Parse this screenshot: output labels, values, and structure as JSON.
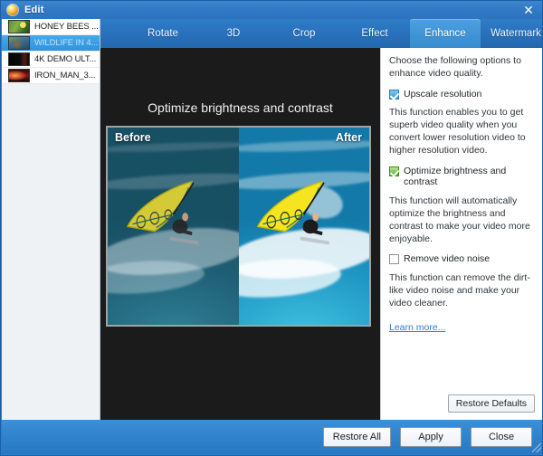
{
  "window": {
    "title": "Edit",
    "icon": "app-logo-icon",
    "close_label": "✕"
  },
  "sidebar": {
    "items": [
      {
        "label": "HONEY BEES ...",
        "thumb": "bees",
        "selected": false
      },
      {
        "label": "WILDLIFE IN 4...",
        "thumb": "wild",
        "selected": true
      },
      {
        "label": "4K DEMO ULT...",
        "thumb": "demo",
        "selected": false
      },
      {
        "label": "IRON_MAN_3...",
        "thumb": "iron",
        "selected": false
      }
    ]
  },
  "tabs": [
    {
      "label": "Rotate",
      "active": false
    },
    {
      "label": "3D",
      "active": false
    },
    {
      "label": "Crop",
      "active": false
    },
    {
      "label": "Effect",
      "active": false
    },
    {
      "label": "Enhance",
      "active": true
    },
    {
      "label": "Watermark",
      "active": false
    }
  ],
  "preview": {
    "title": "Optimize brightness and contrast",
    "before_label": "Before",
    "after_label": "After"
  },
  "options": {
    "intro": "Choose the following options to enhance video quality.",
    "items": [
      {
        "label": "Upscale resolution",
        "checked": true,
        "check_color": "#2f9bdb",
        "description": "This function enables you to get superb video quality when you convert lower resolution video to higher resolution video."
      },
      {
        "label": "Optimize brightness and contrast",
        "checked": true,
        "check_color": "#55ad2c",
        "description": "This function will automatically optimize the brightness and contrast to make your video more enjoyable."
      },
      {
        "label": "Remove video noise",
        "checked": false,
        "check_color": "#8a9199",
        "description": "This function can remove the dirt-like video noise and make your video cleaner."
      }
    ],
    "learn_more": "Learn more...",
    "restore_defaults": "Restore Defaults"
  },
  "footer": {
    "buttons": [
      {
        "label": "Restore All"
      },
      {
        "label": "Apply"
      },
      {
        "label": "Close"
      }
    ]
  },
  "colors": {
    "accent": "#2a7fd4",
    "tab_active": "#3e93d5",
    "panel_bg": "#ffffff",
    "preview_bg": "#1b1b1b",
    "link": "#2a7fd4"
  }
}
